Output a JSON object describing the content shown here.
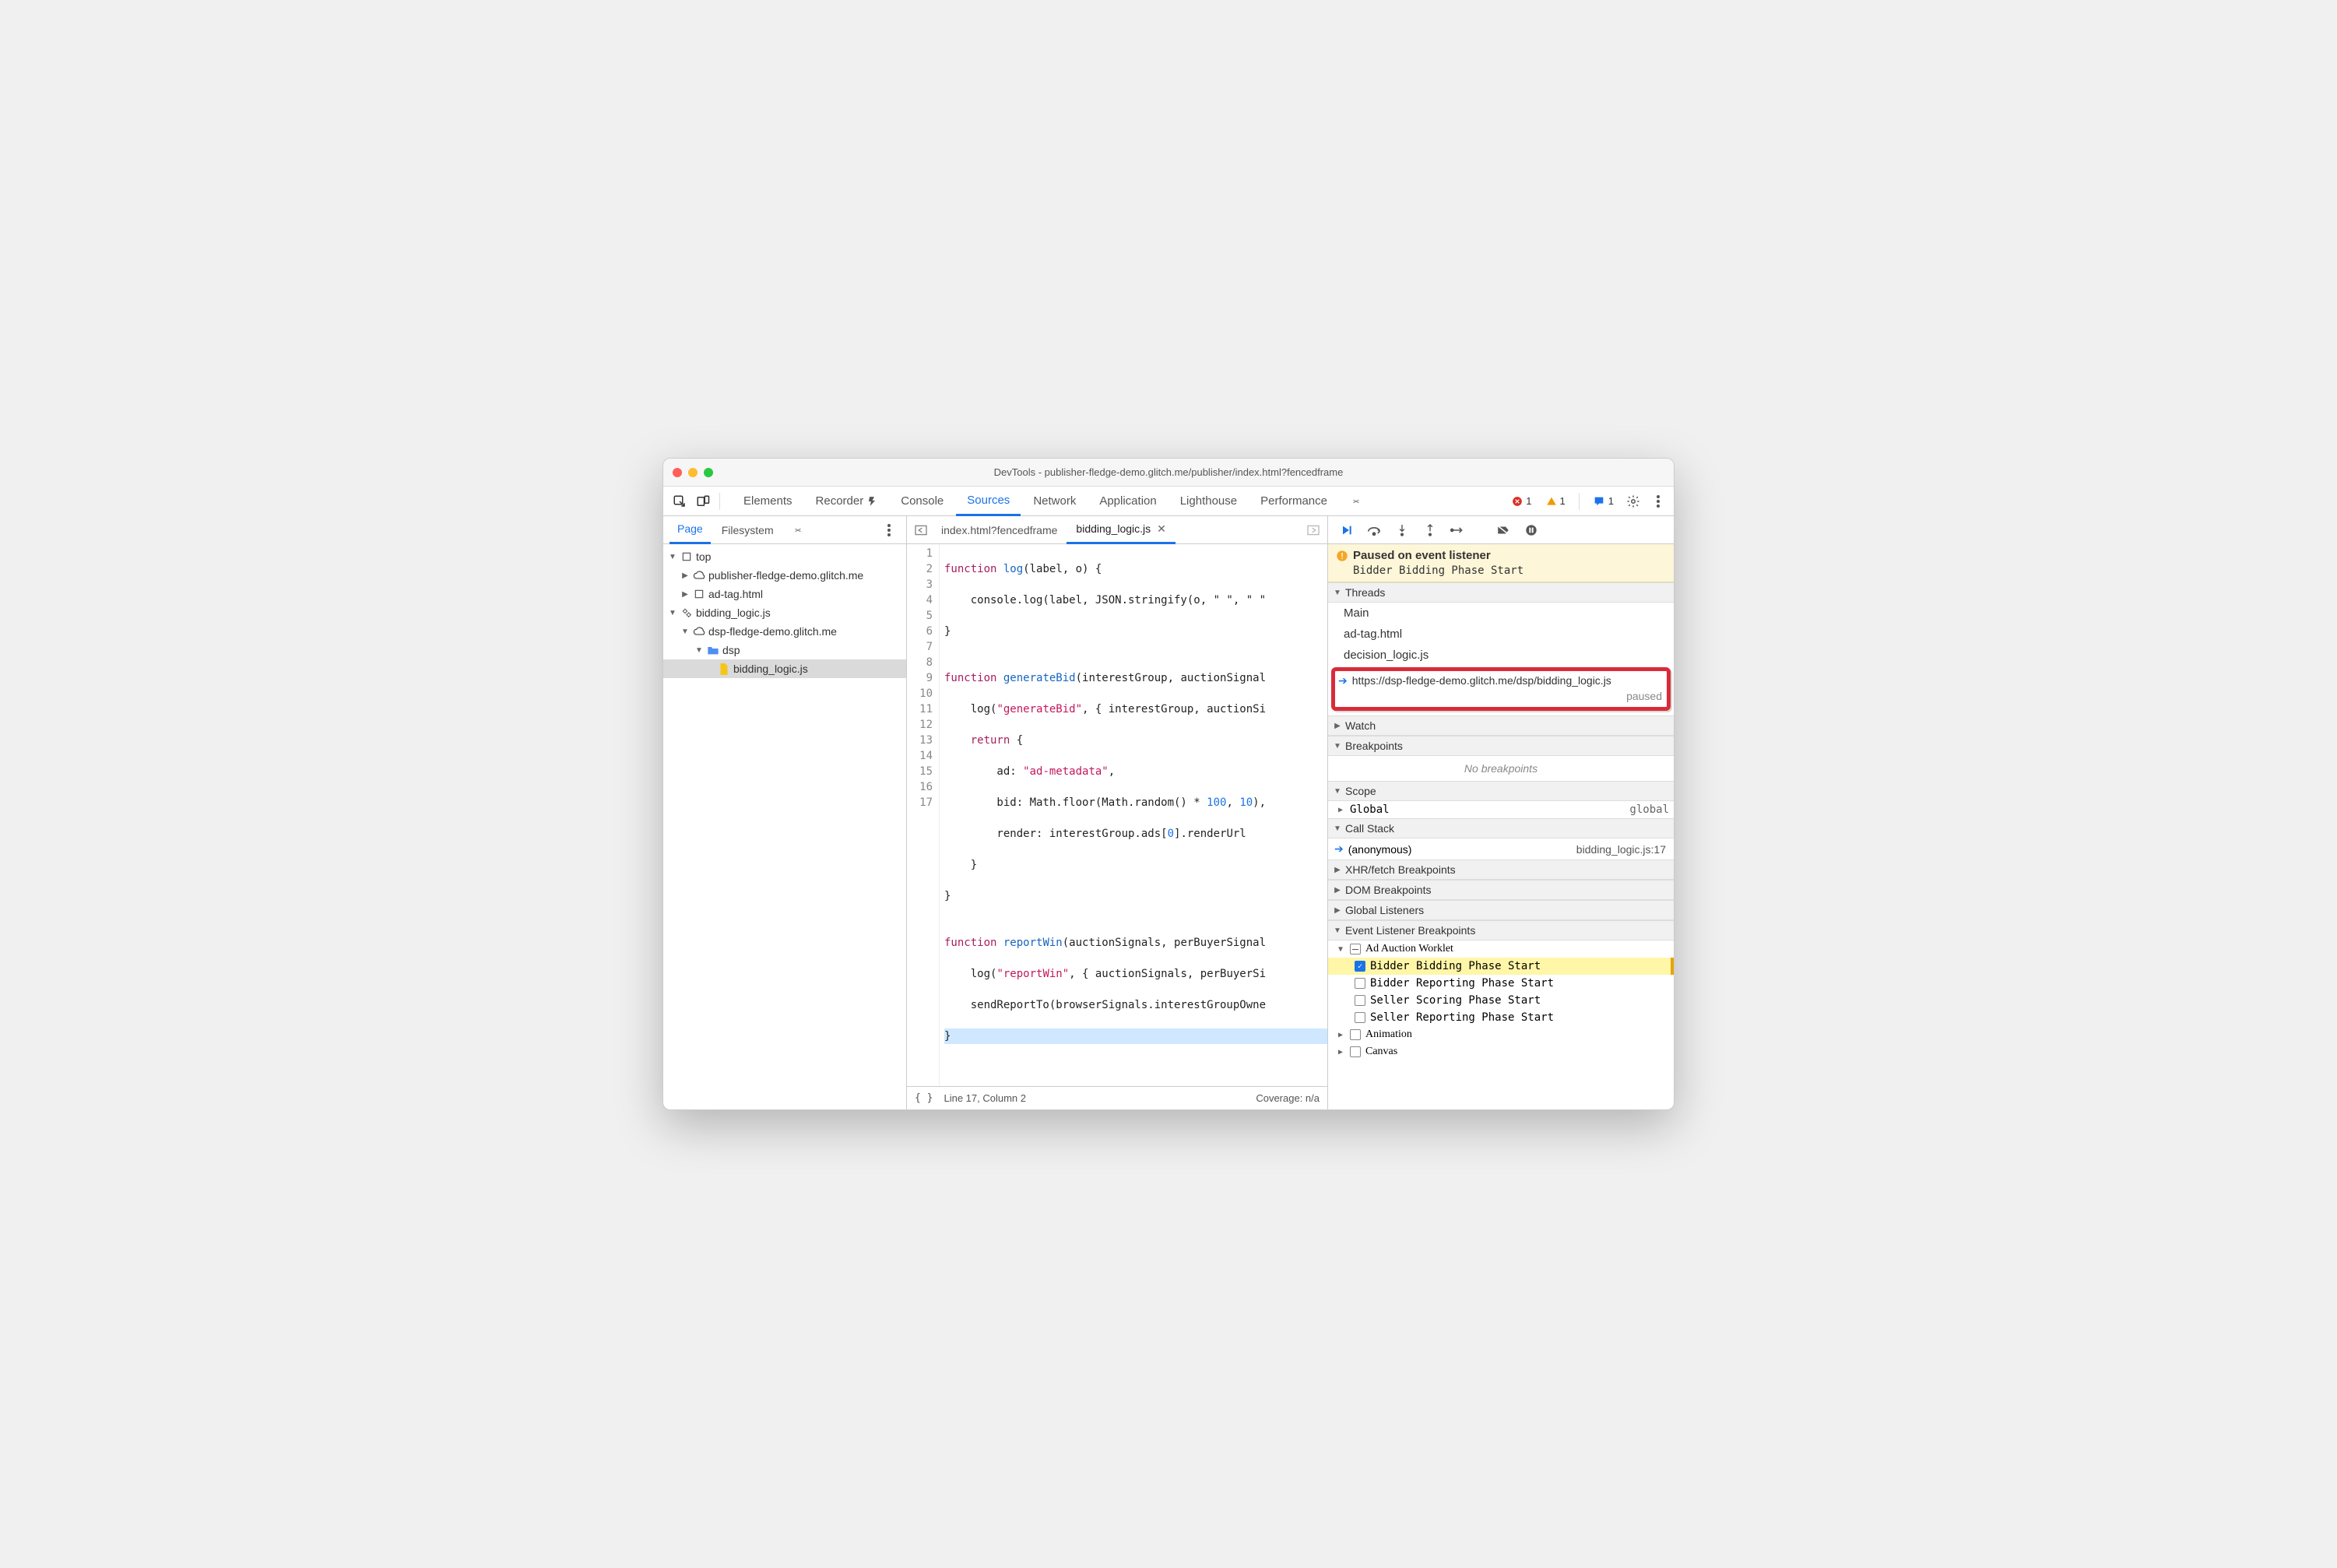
{
  "title": "DevTools - publisher-fledge-demo.glitch.me/publisher/index.html?fencedframe",
  "topTabs": [
    "Elements",
    "Recorder",
    "Console",
    "Sources",
    "Network",
    "Application",
    "Lighthouse",
    "Performance"
  ],
  "topTabsActive": "Sources",
  "counts": {
    "errors": "1",
    "warnings": "1",
    "issues": "1"
  },
  "navTabs": [
    "Page",
    "Filesystem"
  ],
  "navTabsActive": "Page",
  "tree": {
    "top": "top",
    "pub": "publisher-fledge-demo.glitch.me",
    "adtag": "ad-tag.html",
    "worklet": "bidding_logic.js",
    "dsp_origin": "dsp-fledge-demo.glitch.me",
    "dsp_folder": "dsp",
    "dsp_file": "bidding_logic.js"
  },
  "editorTabs": [
    {
      "label": "index.html?fencedframe",
      "active": false
    },
    {
      "label": "bidding_logic.js",
      "active": true
    }
  ],
  "code": {
    "lines": 17,
    "l1": {
      "kw": "function",
      "fn": "log",
      "rest": "(label, o) {"
    },
    "l2": "    console.log(label, JSON.stringify(o, \" \", \" \"",
    "l3": "}",
    "l4": "",
    "l5": {
      "kw": "function",
      "fn": "generateBid",
      "rest": "(interestGroup, auctionSignal"
    },
    "l6a": "    log(",
    "l6s": "\"generateBid\"",
    "l6b": ", { interestGroup, auctionSi",
    "l7": {
      "kw": "return",
      "rest": " {"
    },
    "l8a": "        ad: ",
    "l8s": "\"ad-metadata\"",
    "l8b": ",",
    "l9a": "        bid: Math.floor(Math.random() * ",
    "l9n1": "100",
    "l9b": ", ",
    "l9n2": "10",
    "l9c": "),",
    "l10a": "        render: interestGroup.ads[",
    "l10n": "0",
    "l10b": "].renderUrl",
    "l11": "    }",
    "l12": "}",
    "l13": "",
    "l14": {
      "kw": "function",
      "fn": "reportWin",
      "rest": "(auctionSignals, perBuyerSignal"
    },
    "l15a": "    log(",
    "l15s": "\"reportWin\"",
    "l15b": ", { auctionSignals, perBuyerSi",
    "l16": "    sendReportTo(browserSignals.interestGroupOwne",
    "l17": "}"
  },
  "status": {
    "pos": "Line 17, Column 2",
    "cov": "Coverage: n/a"
  },
  "paused": {
    "title": "Paused on event listener",
    "sub": "Bidder Bidding Phase Start"
  },
  "threads": {
    "header": "Threads",
    "items": [
      "Main",
      "ad-tag.html",
      "decision_logic.js"
    ],
    "highlight": {
      "url": "https://dsp-fledge-demo.glitch.me/dsp/bidding_logic.js",
      "state": "paused"
    }
  },
  "sections": {
    "watch": "Watch",
    "breakpoints": "Breakpoints",
    "noBreakpoints": "No breakpoints",
    "scope": "Scope",
    "global": "Global",
    "globalVal": "global",
    "callstack": "Call Stack",
    "csName": "(anonymous)",
    "csLoc": "bidding_logic.js:17",
    "xhr": "XHR/fetch Breakpoints",
    "dom": "DOM Breakpoints",
    "globalListeners": "Global Listeners",
    "evbp": "Event Listener Breakpoints"
  },
  "eventBreakpoints": {
    "group": "Ad Auction Worklet",
    "items": [
      {
        "label": "Bidder Bidding Phase Start",
        "checked": true,
        "hit": true
      },
      {
        "label": "Bidder Reporting Phase Start",
        "checked": false
      },
      {
        "label": "Seller Scoring Phase Start",
        "checked": false
      },
      {
        "label": "Seller Reporting Phase Start",
        "checked": false
      }
    ],
    "more": [
      "Animation",
      "Canvas"
    ]
  }
}
